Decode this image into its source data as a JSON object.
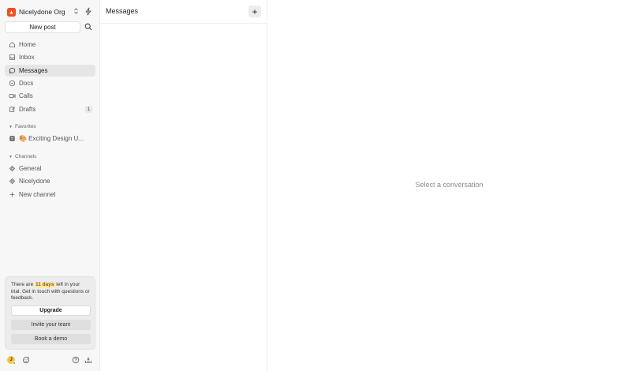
{
  "org": {
    "name": "Nicelydone Org"
  },
  "sidebar": {
    "new_post_label": "New post",
    "nav": [
      {
        "label": "Home",
        "icon": "home-icon"
      },
      {
        "label": "Inbox",
        "icon": "inbox-icon"
      },
      {
        "label": "Messages",
        "icon": "message-icon",
        "active": true
      },
      {
        "label": "Docs",
        "icon": "docs-icon"
      },
      {
        "label": "Calls",
        "icon": "video-icon"
      },
      {
        "label": "Drafts",
        "icon": "draft-icon",
        "badge": "1"
      }
    ],
    "favorites": {
      "label": "Favorites",
      "items": [
        {
          "label": "🎨 Exciting Design U...",
          "icon": "doc-icon"
        }
      ]
    },
    "channels": {
      "label": "Channels",
      "items": [
        {
          "label": "General",
          "icon": "channel-icon"
        },
        {
          "label": "Nicelydone",
          "icon": "channel-icon"
        }
      ],
      "new_channel_label": "New channel"
    }
  },
  "trial": {
    "text_before": "There are ",
    "highlight": "11 days",
    "text_after": " left in your trial. Get in touch with questions or feedback.",
    "upgrade_label": "Upgrade",
    "invite_label": "Invite your team",
    "demo_label": "Book a demo"
  },
  "footer": {
    "avatar_initial": "J"
  },
  "list_pane": {
    "title": "Messages"
  },
  "main": {
    "empty_text": "Select a conversation"
  },
  "colors": {
    "brand": "#f04e23",
    "active_bg": "#e6e6e6",
    "highlight": "#fde7a7"
  }
}
